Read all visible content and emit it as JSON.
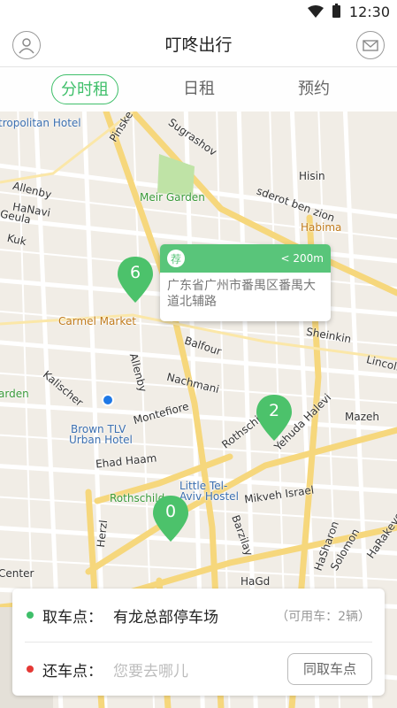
{
  "status_bar": {
    "time": "12:30"
  },
  "header": {
    "title": "叮咚出行"
  },
  "tabs": [
    {
      "label": "分时租",
      "active": true
    },
    {
      "label": "日租",
      "active": false
    },
    {
      "label": "预约",
      "active": false
    }
  ],
  "map": {
    "labels": {
      "metropolitan_hotel": "tropolitan Hotel",
      "pinske": "Pinske",
      "sugrashov": "Sugrashov",
      "meir_garden": "Meir Garden",
      "allenby_top": "Allenby",
      "hanavi": "HaNavi",
      "geula": "Geula",
      "kuk": "Kuk",
      "hisin": "Hisin",
      "sderot_ben_zion": "sderot ben zion",
      "habima": "Habima",
      "carmel_market": "Carmel Market",
      "balfour": "Balfour",
      "sheinkin": "Sheinkin",
      "lincoln": "Lincoln",
      "allenby_mid": "Allenby",
      "nachmani": "Nachmani",
      "kalischer": "Kalischer",
      "garden_left": "arden",
      "montefiore": "Montefiore",
      "mazeh": "Mazeh",
      "brown_tlv_1": "Brown TLV",
      "brown_tlv_2": "Urban Hotel",
      "rothschild_diag": "Rothschild",
      "yehuda_halevi": "Yehuda Halevi",
      "ehad_haam": "Ehad Haam",
      "rothschild": "Rothschild",
      "little_tel_aviv_1": "Little Tel-",
      "little_tel_aviv_2": "Aviv Hostel",
      "mikveh_israel": "Mikveh Israel",
      "herzl": "Herzl",
      "barzilay": "Barzilay",
      "hasharon": "HaSharon",
      "solomon": "Solomon",
      "harakevet": "HaRakevet",
      "center": "Center",
      "hagdud": "HaGd"
    },
    "pins": [
      {
        "count": "6"
      },
      {
        "count": "2"
      },
      {
        "count": "0"
      }
    ],
    "popup": {
      "badge": "荐",
      "distance": "< 200m",
      "address": "广东省广州市番禺区番禺大道北辅路"
    }
  },
  "panel": {
    "pickup_label": "取车点：",
    "pickup_value": "有龙总部停车场",
    "available_text": "（可用车：2辆）",
    "return_label": "还车点：",
    "return_placeholder": "您要去哪儿",
    "same_button": "同取车点"
  },
  "colors": {
    "accent_green": "#3fbf6a",
    "pin_green": "#4cc26b",
    "return_red": "#e53935"
  }
}
